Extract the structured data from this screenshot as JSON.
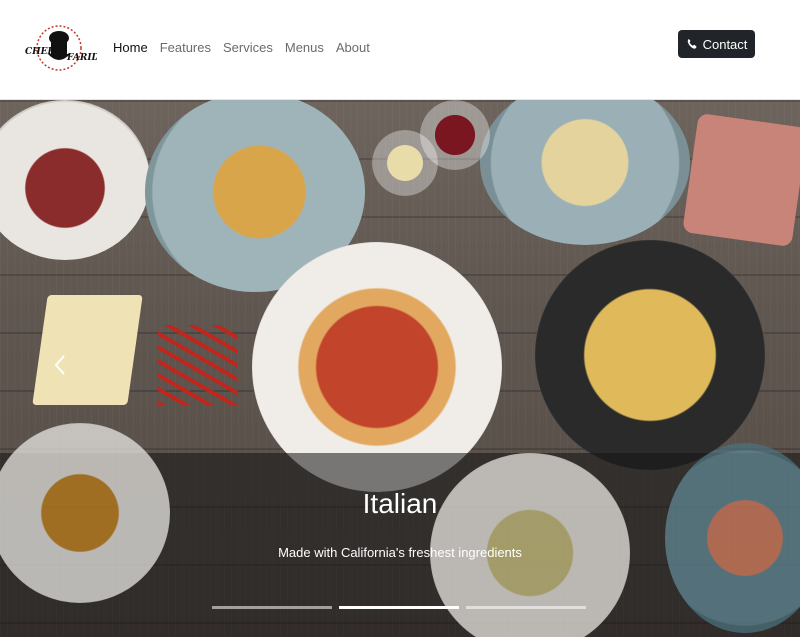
{
  "brand": {
    "logo_top_text": "CHEF",
    "logo_bottom_text": "FARID"
  },
  "nav": {
    "items": [
      {
        "label": "Home",
        "active": true
      },
      {
        "label": "Features",
        "active": false
      },
      {
        "label": "Services",
        "active": false
      },
      {
        "label": "Menus",
        "active": false
      },
      {
        "label": "About",
        "active": false
      }
    ],
    "contact_label": "Contact",
    "contact_icon": "phone-icon"
  },
  "carousel": {
    "slide_title": "Italian",
    "slide_caption": "Made with California's freshest ingredients",
    "indicators": 3,
    "active_index": 1,
    "prev_icon": "chevron-left-icon"
  },
  "colors": {
    "button_bg": "#212529",
    "nav_active": "#111111",
    "nav_text": "#6b6b6b"
  }
}
